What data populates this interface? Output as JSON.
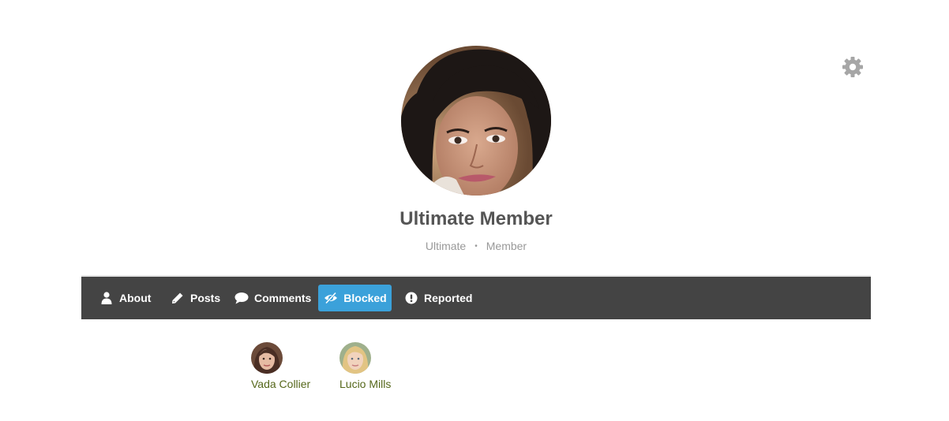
{
  "profile": {
    "name": "Ultimate Member",
    "first_name": "Ultimate",
    "last_name": "Member",
    "separator": "•"
  },
  "icons": {
    "settings": "gear-icon",
    "about": "user-icon",
    "posts": "pencil-icon",
    "comments": "comment-icon",
    "blocked": "eye-slash-icon",
    "reported": "exclamation-circle-icon"
  },
  "colors": {
    "nav_background": "#444444",
    "active_tab": "#3ba1da",
    "name_text": "#555555",
    "meta_text": "#999999",
    "link_text": "#55671a",
    "gear": "#a6a6a6"
  },
  "nav": {
    "tabs": [
      {
        "label": "About"
      },
      {
        "label": "Posts"
      },
      {
        "label": "Comments"
      },
      {
        "label": "Blocked",
        "active": true
      },
      {
        "label": "Reported"
      }
    ]
  },
  "blocked_users": [
    {
      "name": "Vada Collier"
    },
    {
      "name": "Lucio Mills"
    }
  ]
}
